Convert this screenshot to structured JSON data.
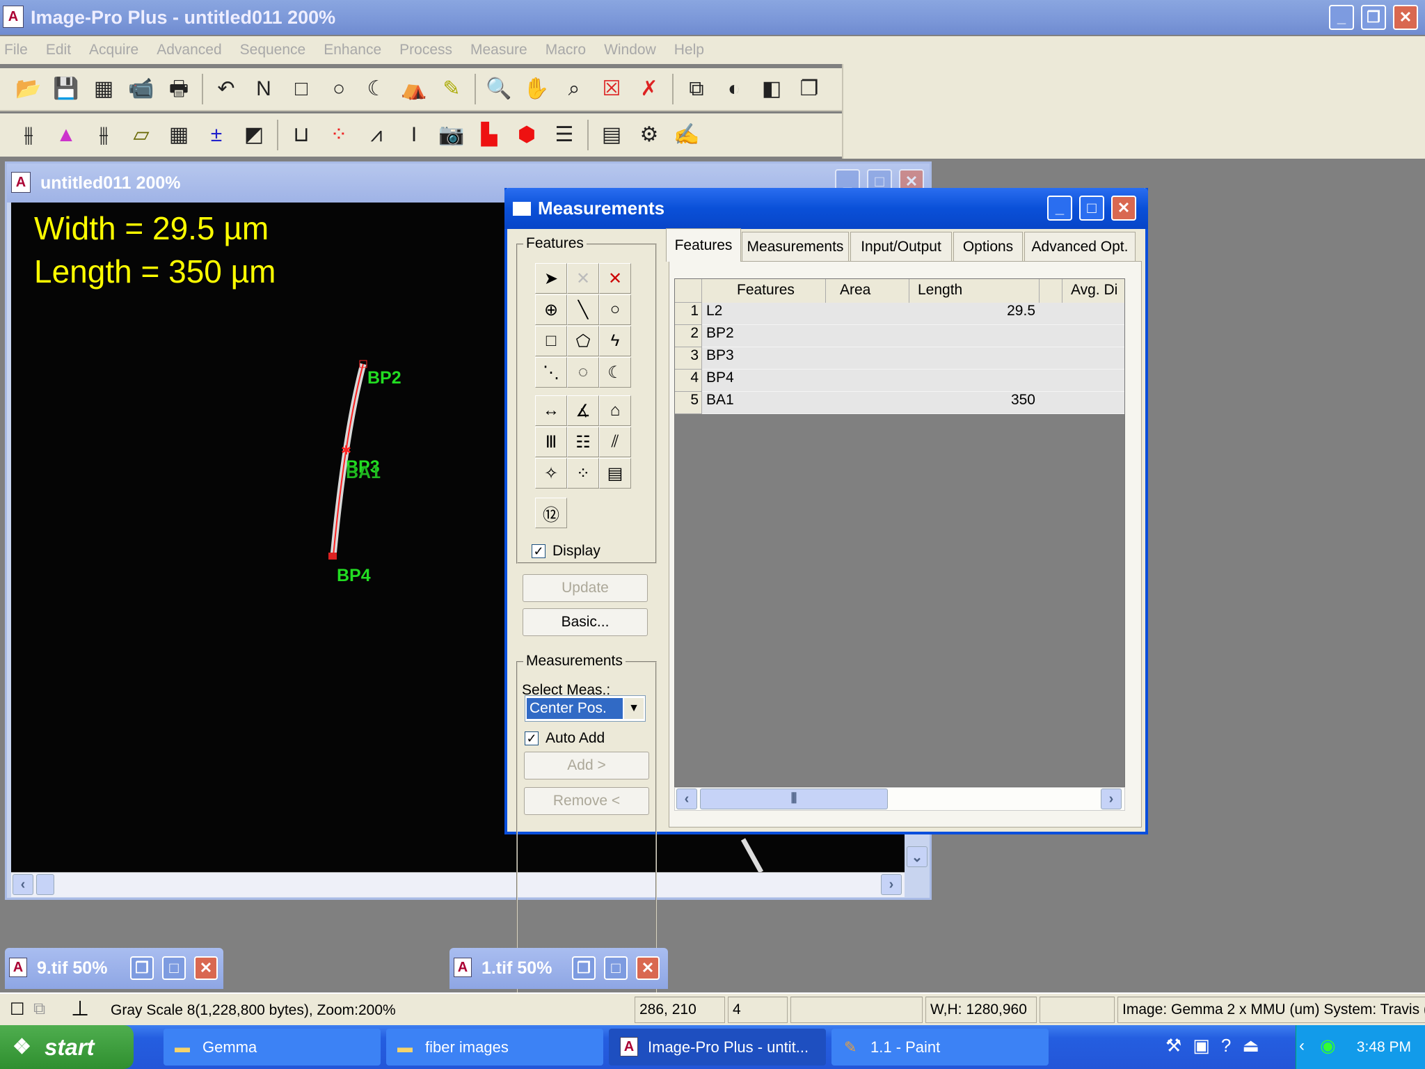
{
  "app": {
    "title": "Image-Pro Plus - untitled011 200%"
  },
  "menu": [
    "File",
    "Edit",
    "Acquire",
    "Advanced",
    "Sequence",
    "Enhance",
    "Process",
    "Measure",
    "Macro",
    "Window",
    "Help"
  ],
  "toolbar1": [
    "open-icon",
    "save-icon",
    "grid-icon",
    "camera-icon",
    "print-icon",
    "|",
    "undo-icon",
    "new-aoi-icon",
    "rectangle-aoi-icon",
    "ellipse-aoi-icon",
    "irregular-aoi-icon",
    "magic-wand-icon",
    "pencil-icon",
    "|",
    "zoom-icon",
    "pan-hand-icon",
    "zoom-region-icon",
    "delete-image-icon",
    "delete-all-icon",
    "|",
    "tile-images-icon",
    "contrast-icon",
    "color-icon",
    "cascade-icon"
  ],
  "toolbar2": [
    "levels-icon",
    "histogram-icon",
    "filters-icon",
    "layers-icon",
    "spatial-calibration-icon",
    "arithmetic-icon",
    "color-map-icon",
    "|",
    "bitmap-icon",
    "count-size-icon",
    "calipers-icon",
    "intensity-calibration-icon",
    "capture-icon",
    "line-profile-icon",
    "3d-icon",
    "data-collector-icon",
    "|",
    "macro-icon",
    "settings-icon",
    "edit-macro-icon"
  ],
  "child": {
    "title": "untitled011 200%",
    "overlay_width": "Width = 29.5 µm",
    "overlay_length": "Length = 350 µm",
    "labels": {
      "bp2": "BP2",
      "bp3": "BP3",
      "ba1": "BA1",
      "bp4": "BP4"
    }
  },
  "dialog": {
    "title": "Measurements",
    "features_group": "Features",
    "display_label": "Display",
    "display_checked": true,
    "update": "Update",
    "basic": "Basic...",
    "meas_group": "Measurements",
    "select_meas": "Select Meas.:",
    "select_value": "Center Pos.",
    "auto_add": "Auto Add",
    "auto_add_checked": true,
    "add": "Add >",
    "remove": "Remove <",
    "tabs": [
      "Features",
      "Measurements",
      "Input/Output",
      "Options",
      "Advanced Opt."
    ],
    "active_tab": "Features",
    "columns": [
      "Features",
      "Area",
      "Length",
      "Avg. Di"
    ],
    "rows": [
      {
        "n": "1",
        "feature": "L2",
        "area": "",
        "length": "29.5"
      },
      {
        "n": "2",
        "feature": "BP2",
        "area": "",
        "length": ""
      },
      {
        "n": "3",
        "feature": "BP3",
        "area": "",
        "length": ""
      },
      {
        "n": "4",
        "feature": "BP4",
        "area": "",
        "length": ""
      },
      {
        "n": "5",
        "feature": "BA1",
        "area": "",
        "length": "350"
      }
    ]
  },
  "minimized": [
    {
      "title": "9.tif 50%"
    },
    {
      "title": "1.tif 50%"
    }
  ],
  "status": {
    "info": "Gray Scale 8(1,228,800 bytes), Zoom:200%",
    "coords": "286, 210",
    "value": "4",
    "wh": "W,H: 1280,960",
    "system": "Image: Gemma 2 x MMU (um) System: Travis ("
  },
  "taskbar": {
    "start": "start",
    "tasks": [
      "Gemma",
      "fiber images",
      "Image-Pro Plus - untit...",
      "1.1 - Paint"
    ],
    "clock": "3:48 PM"
  }
}
